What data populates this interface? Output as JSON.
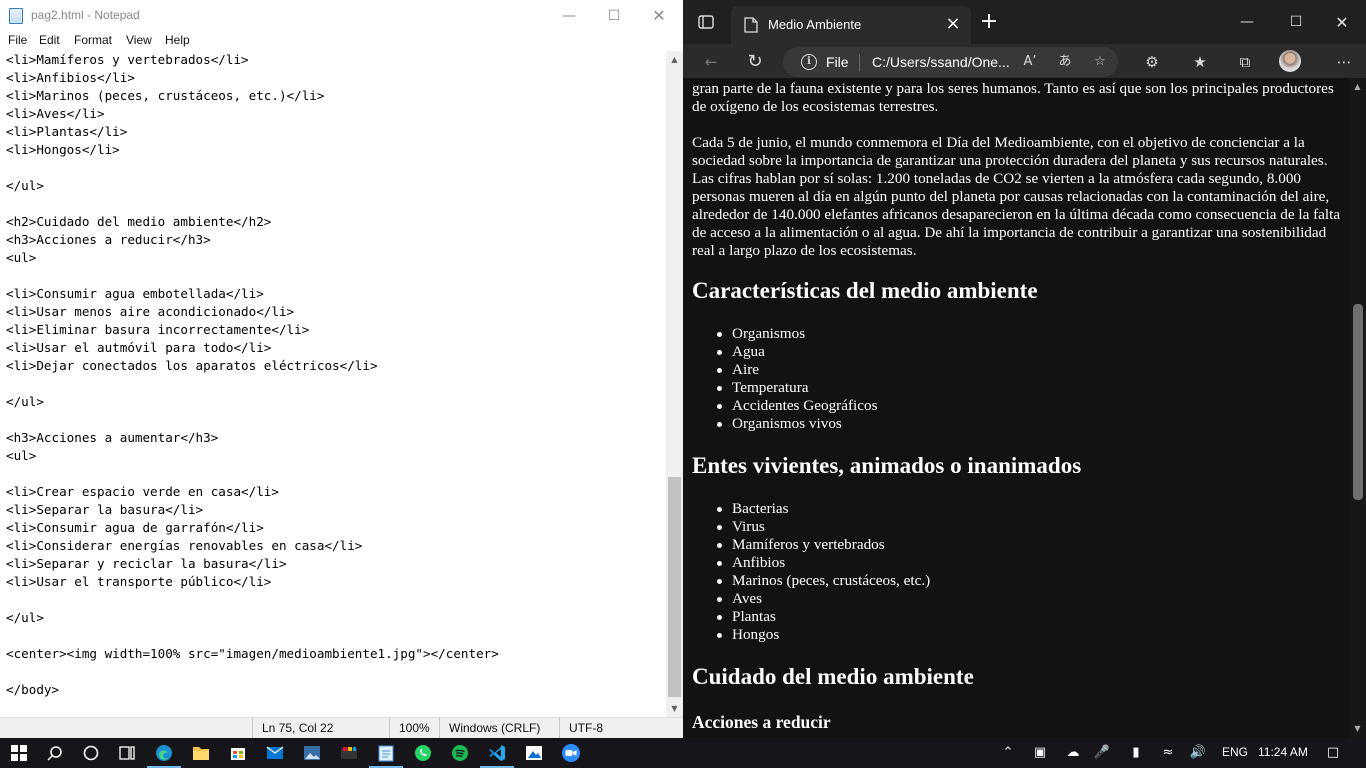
{
  "notepad": {
    "title": "pag2.html - Notepad",
    "menu": [
      "File",
      "Edit",
      "Format",
      "View",
      "Help"
    ],
    "lines": [
      "<li>Mamíferos y vertebrados</li>",
      "<li>Anfibios</li>",
      "<li>Marinos (peces, crustáceos, etc.)</li>",
      "<li>Aves</li>",
      "<li>Plantas</li>",
      "<li>Hongos</li>",
      "",
      "</ul>",
      "",
      "<h2>Cuidado del medio ambiente</h2>",
      "<h3>Acciones a reducir</h3>",
      "<ul>",
      "",
      "<li>Consumir agua embotellada</li>",
      "<li>Usar menos aire acondicionado</li>",
      "<li>Eliminar basura incorrectamente</li>",
      "<li>Usar el autmóvil para todo</li>",
      "<li>Dejar conectados los aparatos eléctricos</li>",
      "",
      "</ul>",
      "",
      "<h3>Acciones a aumentar</h3>",
      "<ul>",
      "",
      "<li>Crear espacio verde en casa</li>",
      "<li>Separar la basura</li>",
      "<li>Consumir agua de garrafón</li>",
      "<li>Considerar energías renovables en casa</li>",
      "<li>Separar y reciclar la basura</li>",
      "<li>Usar el transporte público</li>",
      "",
      "</ul>",
      "",
      "<center><img width=100% src=\"imagen/medioambiente1.jpg\"></center>",
      "",
      "</body>"
    ],
    "status": {
      "position": "Ln 75, Col 22",
      "zoom": "100%",
      "line_ending": "Windows (CRLF)",
      "encoding": "UTF-8"
    }
  },
  "browser": {
    "tab_title": "Medio Ambiente",
    "file_label": "File",
    "url": "C:/Users/ssand/One...",
    "page": {
      "intro_tail": "gran parte de la fauna existente y para los seres humanos. Tanto es así que son los principales productores de oxígeno de los ecosistemas terrestres.",
      "paragraph": "Cada 5 de junio, el mundo conmemora el Día del Medioambiente, con el objetivo de concienciar a la sociedad sobre la importancia de garantizar una protección duradera del planeta y sus recursos naturales. Las cifras hablan por sí solas: 1.200 toneladas de CO2 se vierten a la atmósfera cada segundo, 8.000 personas mueren al día en algún punto del planeta por causas relacionadas con la contaminación del aire, alrededor de 140.000 elefantes africanos desaparecieron en la última década como consecuencia de la falta de acceso a la alimentación o al agua. De ahí la importancia de contribuir a garantizar una sostenibilidad real a largo plazo de los ecosistemas.",
      "heading_caracteristicas": "Características del medio ambiente",
      "list_caracteristicas": [
        "Organismos",
        "Agua",
        "Aire",
        "Temperatura",
        "Accidentes Geográficos",
        "Organismos vivos"
      ],
      "heading_entes": "Entes vivientes, animados o inanimados",
      "list_entes": [
        "Bacterias",
        "Virus",
        "Mamíferos y vertebrados",
        "Anfibios",
        "Marinos (peces, crustáceos, etc.)",
        "Aves",
        "Plantas",
        "Hongos"
      ],
      "heading_cuidado": "Cuidado del medio ambiente",
      "subheading_reducir": "Acciones a reducir"
    }
  },
  "taskbar": {
    "language": "ENG",
    "time": "11:24 AM",
    "icons": [
      "start-icon",
      "search-icon",
      "cortana-icon",
      "task-view-icon",
      "edge-icon",
      "file-explorer-icon",
      "store-icon",
      "mail-icon",
      "photos-icon",
      "app-icon",
      "notepad-icon",
      "whatsapp-icon",
      "spotify-icon",
      "vscode-icon",
      "paint-icon",
      "zoom-icon"
    ]
  }
}
